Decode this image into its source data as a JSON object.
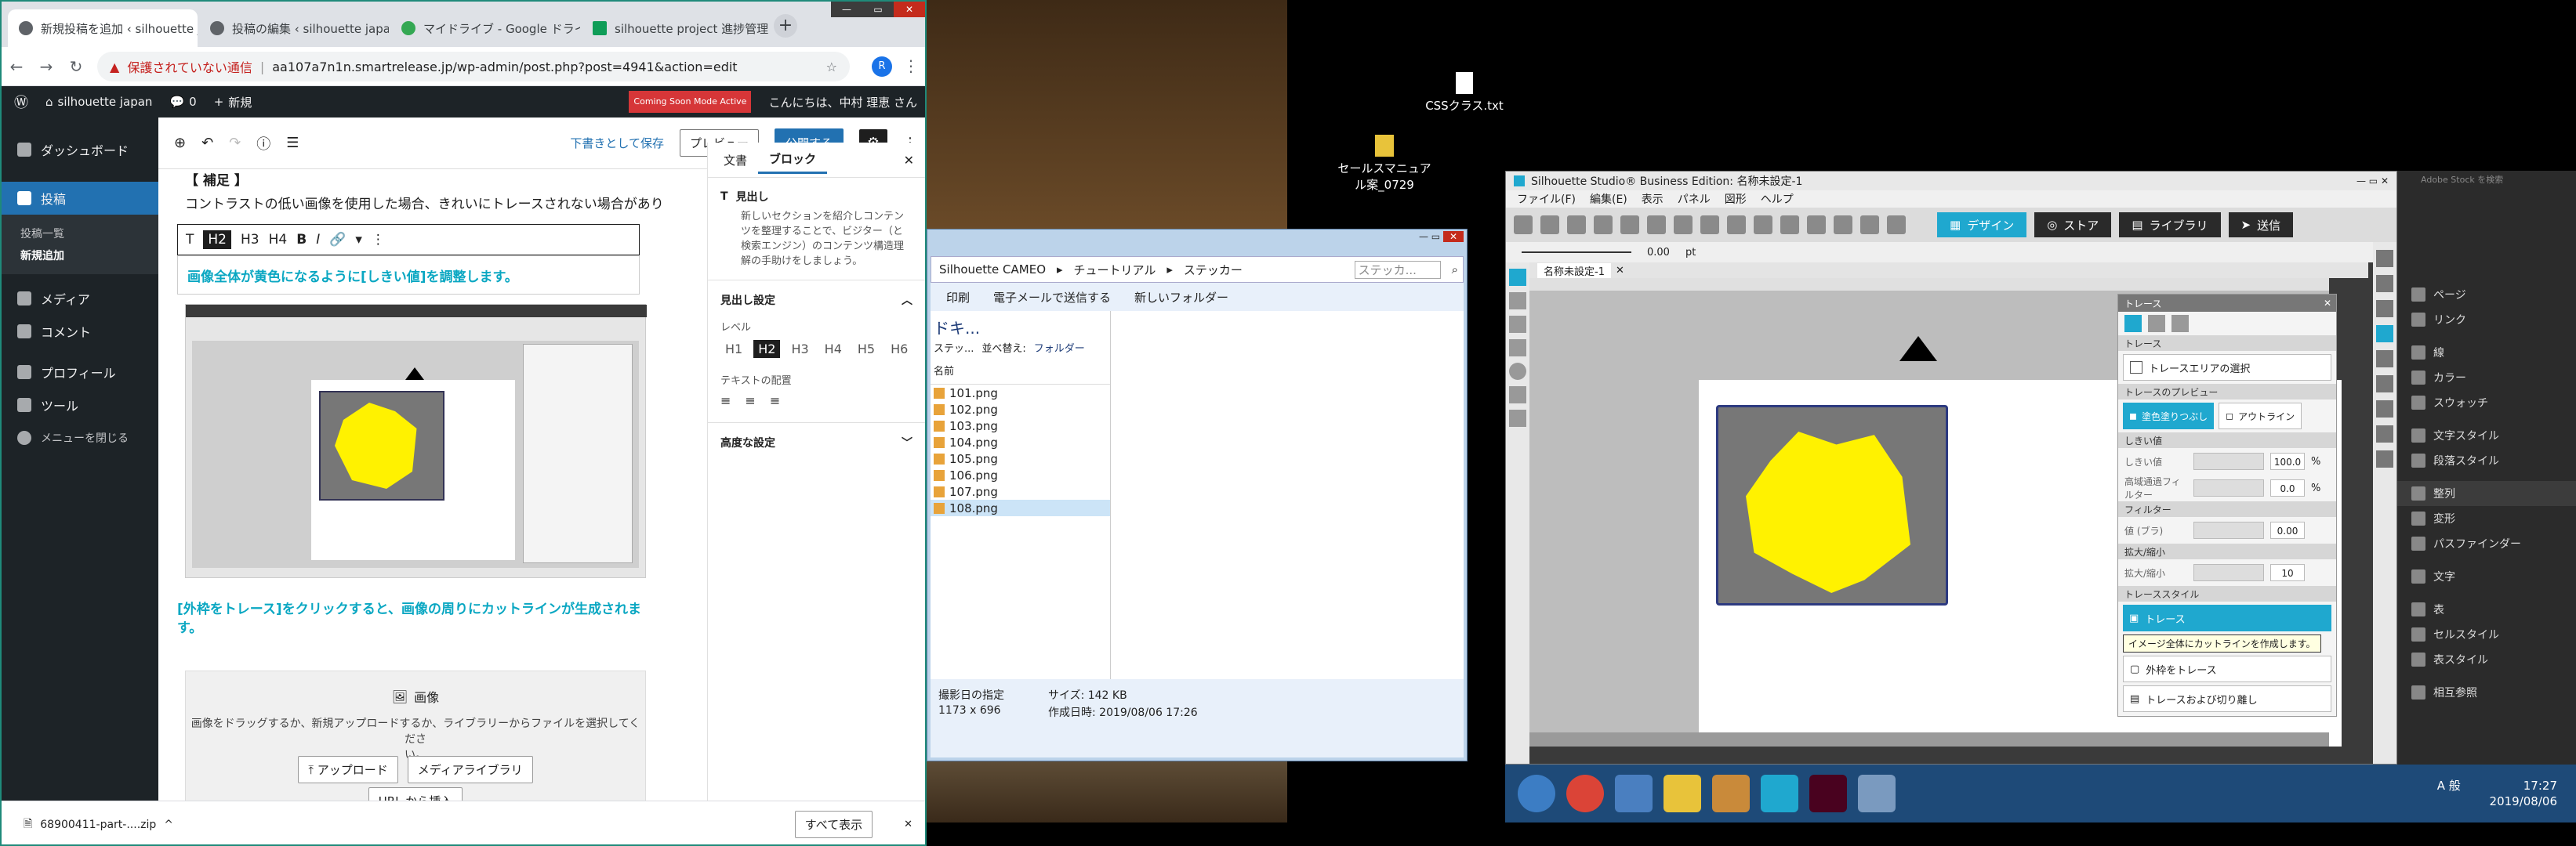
{
  "chrome": {
    "tabs": [
      {
        "label": "新規投稿を追加 ‹ silhouette jap"
      },
      {
        "label": "投稿の編集 ‹ silhouette japa"
      },
      {
        "label": "マイドライブ - Google ドライ"
      },
      {
        "label": "silhouette project 進捗管理"
      }
    ],
    "url_warning": "保護されていない通信",
    "url": "aa107a7n1n.smartrelease.jp/wp-admin/post.php?post=4941&action=edit",
    "profile_initial": "R",
    "download_file": "68900411-part-....zip",
    "show_all": "すべて表示"
  },
  "wp": {
    "site_name": "silhouette japan",
    "comments_count": "0",
    "new_label": "新規",
    "coming_soon": "Coming Soon Mode Active",
    "greeting": "こんにちは、中村 理恵 さん",
    "menu": {
      "dashboard": "ダッシュボード",
      "posts": "投稿",
      "posts_list": "投稿一覧",
      "posts_new": "新規追加",
      "media": "メディア",
      "comments": "コメント",
      "profile": "プロフィール",
      "tools": "ツール",
      "collapse": "メニューを閉じる"
    },
    "editor": {
      "save_draft": "下書きとして保存",
      "preview": "プレビュー",
      "publish": "公開する",
      "heading_note": "【 補足 】",
      "para1": "コントラストの低い画像を使用した場合、きれいにトレースされない場合があり",
      "highlight1": "画像全体が黄色になるように[しきい値]を調整します。",
      "highlight2a": "[外枠をトレース]をクリックすると、画像の周りにカットラインが生成されま",
      "highlight2b": "す。",
      "image_block_title": "画像",
      "image_block_desc": "画像をドラッグするか、新規アップロードするか、ライブラリーからファイルを選択してくださ",
      "image_block_desc2": "い。",
      "upload": "アップロード",
      "media_library": "メディアライブラリ",
      "url_insert": "URL から挿入"
    },
    "sidebar": {
      "tab_doc": "文書",
      "tab_block": "ブロック",
      "block_name": "見出し",
      "block_desc": "新しいセクションを紹介しコンテンツを整理することで、ビジター（と検索エンジン）のコンテンツ構造理解の手助けをしましょう。",
      "heading_settings": "見出し設定",
      "level_label": "レベル",
      "levels": [
        "H1",
        "H2",
        "H3",
        "H4",
        "H5",
        "H6"
      ],
      "text_align": "テキストの配置",
      "advanced": "高度な設定"
    }
  },
  "desktop": {
    "icon1": "CSSクラス.txt",
    "icon2a": "セールスマニュア",
    "icon2b": "ル案_0729"
  },
  "explorer": {
    "path": [
      "Silhouette CAMEO",
      "チュートリアル",
      "ステッカー"
    ],
    "search_placeholder": "ステッカ...",
    "toolbar": [
      "印刷",
      "電子メールで送信する",
      "新しいフォルダー"
    ],
    "folder_title": "ドキ...",
    "folder_sub": "ステッ...",
    "sort_label": "並べ替え:",
    "sort_value": "フォルダー",
    "name_col": "名前",
    "files": [
      "101.png",
      "102.png",
      "103.png",
      "104.png",
      "105.png",
      "106.png",
      "107.png",
      "108.png"
    ],
    "info_date_label": "撮影日の指定",
    "info_dims": "1173 x 696",
    "info_size": "サイズ: 142 KB",
    "info_created": "作成日時: 2019/08/06 17:26"
  },
  "silhouette": {
    "title": "Silhouette Studio® Business Edition: 名称未設定-1",
    "menu": [
      "ファイル(F)",
      "編集(E)",
      "表示",
      "パネル",
      "図形",
      "ヘルプ"
    ],
    "tabs": [
      "デザイン",
      "ストア",
      "ライブラリ",
      "送信"
    ],
    "stroke_value": "0.00",
    "stroke_unit": "pt",
    "doc_tab": "名称未設定-1",
    "trace_panel": {
      "title": "トレース",
      "sec_trace": "トレース",
      "select_area": "トレースエリアの選択",
      "sec_preview": "トレースのプレビュー",
      "fill_preview": "塗色塗りつぶし",
      "outline_preview": "アウトライン",
      "sec_threshold": "しきい値",
      "threshold_label": "しきい値",
      "threshold_value": "100.0",
      "hp_label": "高域通過フィルター",
      "hp_value": "0.0",
      "sec_filter": "フィルター",
      "blur_label": "値 (ブラ)",
      "blur_value": "0.00",
      "sec_scale": "拡大/縮小",
      "scale_label": "拡大/縮小",
      "scale_value": "10",
      "sec_style": "トレーススタイル",
      "trace_btn": "トレース",
      "tooltip": "イメージ全体にカットラインを作成します。",
      "outer_trace": "外枠をトレース",
      "trace_detach": "トレースおよび切り離し"
    },
    "right_panel": [
      "ページ",
      "リンク",
      "線",
      "カラー",
      "スウォッチ",
      "文字スタイル",
      "段落スタイル",
      "整列",
      "変形",
      "パスファインダー",
      "文字",
      "表",
      "セルスタイル",
      "表スタイル",
      "相互参照"
    ],
    "search_box": "Adobe Stock を検索"
  },
  "taskbar": {
    "time": "17:27",
    "date": "2019/08/06",
    "ime": "A 般"
  },
  "colors": {
    "wp_dark": "#1d2327",
    "wp_blue": "#2271b1",
    "highlight": "#0aa7c2",
    "silhouette_accent": "#1fa8cf",
    "trace_yellow": "#fff200"
  }
}
